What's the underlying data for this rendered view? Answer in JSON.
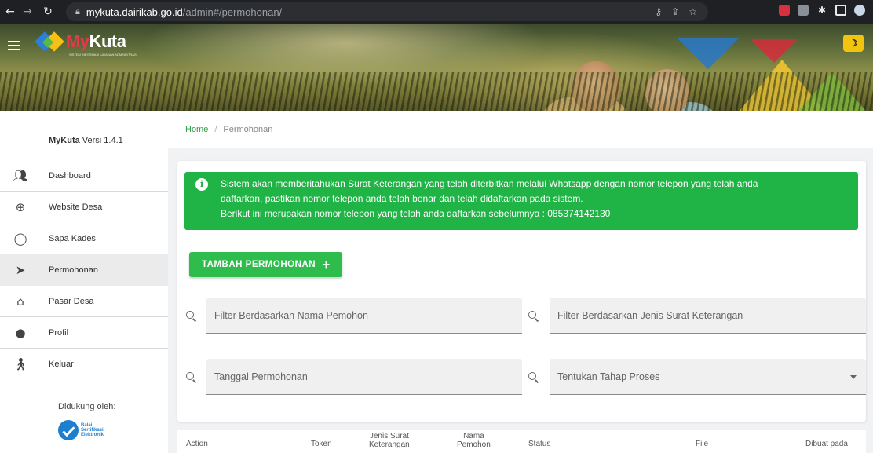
{
  "browser": {
    "url_domain": "mykuta.dairikab.go.id",
    "url_path": "/admin#/permohonan/"
  },
  "header": {
    "logo_my": "My",
    "logo_kuta": "Kuta",
    "logo_tagline": "SISTEM INFORMASI LAYANAN ADMINISTRASI"
  },
  "sidebar": {
    "version_name": "MyKuta",
    "version_text": " Versi 1.4.1",
    "items": [
      {
        "label": "Dashboard",
        "icon": "users-icon"
      },
      {
        "label": "Website Desa",
        "icon": "globe-icon"
      },
      {
        "label": "Sapa Kades",
        "icon": "chat-bubble-icon"
      },
      {
        "label": "Permohonan",
        "icon": "send-icon"
      },
      {
        "label": "Pasar Desa",
        "icon": "shopping-bag-icon"
      },
      {
        "label": "Profil",
        "icon": "account-circle-icon"
      },
      {
        "label": "Keluar",
        "icon": "walking-person-icon"
      }
    ],
    "support_label": "Didukung oleh:",
    "support_logo_lines": [
      "Balai",
      "Sertifikasi",
      "Elektronik"
    ]
  },
  "breadcrumb": {
    "home": "Home",
    "separator": "/",
    "current": "Permohonan"
  },
  "alert": {
    "line1": "Sistem akan memberitahukan Surat Keterangan yang telah diterbitkan melalui Whatsapp dengan nomor telepon yang telah anda",
    "line2": "daftarkan, pastikan nomor telepon anda telah benar dan telah didaftarkan pada sistem.",
    "line3": "Berikut ini merupakan nomor telepon yang telah anda daftarkan sebelumnya : 085374142130",
    "color": "#20b345"
  },
  "actions": {
    "add_label": "TAMBAH PERMOHONAN",
    "add_icon": "+"
  },
  "filters": {
    "nama_placeholder": "Filter Berdasarkan Nama Pemohon",
    "jenis_placeholder": "Filter Berdasarkan Jenis Surat Keterangan",
    "tanggal_placeholder": "Tanggal Permohonan",
    "tahap_placeholder": "Tentukan Tahap Proses"
  },
  "table": {
    "headers": {
      "action": "Action",
      "token": "Token",
      "jenis_1": "Jenis Surat",
      "jenis_2": "Keterangan",
      "nama_1": "Nama",
      "nama_2": "Pemohon",
      "status": "Status",
      "file": "File",
      "dibuat": "Dibuat pada"
    }
  }
}
